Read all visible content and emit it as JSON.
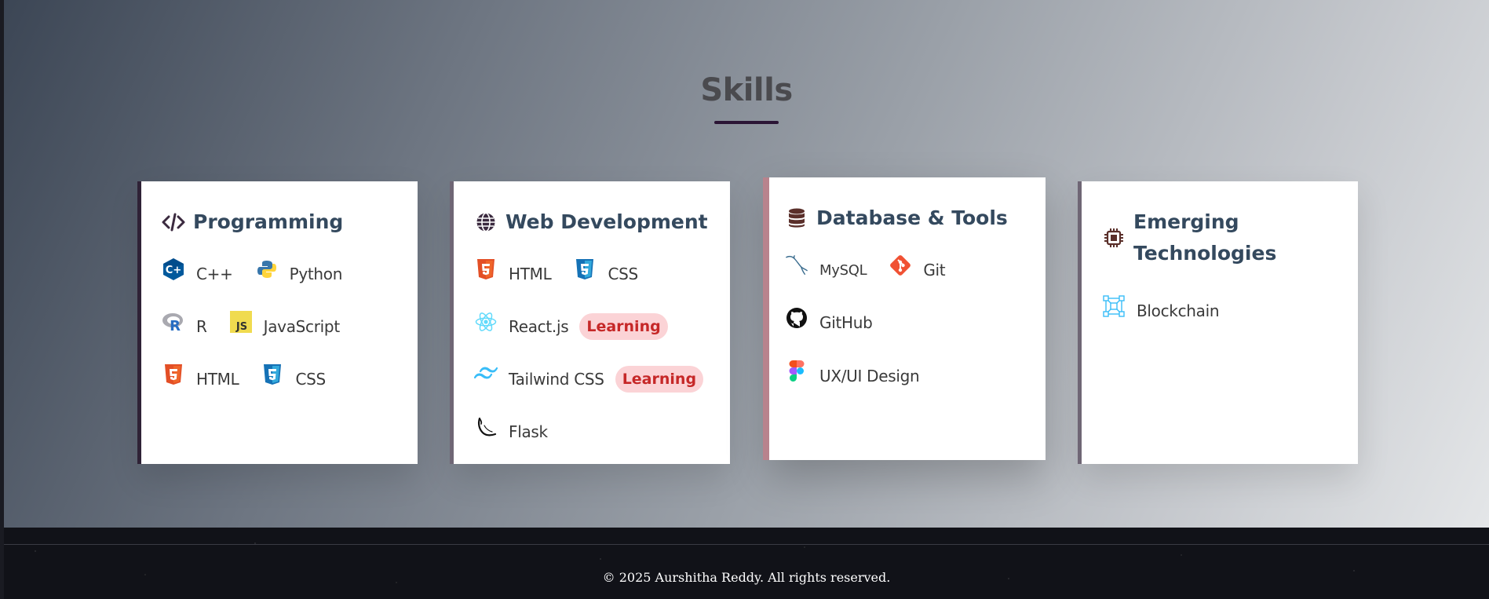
{
  "section": {
    "title": "Skills"
  },
  "cards": {
    "programming": {
      "title": "Programming",
      "icon": "code-icon",
      "accent": "#2f2236",
      "items": [
        {
          "label": "C++",
          "icon": "cpp-icon"
        },
        {
          "label": "Python",
          "icon": "python-icon"
        },
        {
          "label": "R",
          "icon": "r-icon"
        },
        {
          "label": "JavaScript",
          "icon": "javascript-icon"
        },
        {
          "label": "HTML",
          "icon": "html5-icon"
        },
        {
          "label": "CSS",
          "icon": "css3-icon"
        }
      ]
    },
    "web": {
      "title": "Web Development",
      "icon": "globe-icon",
      "accent": "#6f6675",
      "items": [
        {
          "label": "HTML",
          "icon": "html5-icon"
        },
        {
          "label": "CSS",
          "icon": "css3-icon"
        },
        {
          "label": "React.js",
          "icon": "react-icon",
          "badge": "Learning"
        },
        {
          "label": "Tailwind CSS",
          "icon": "tailwind-icon",
          "badge": "Learning"
        },
        {
          "label": "Flask",
          "icon": "flask-icon"
        }
      ]
    },
    "database": {
      "title": "Database & Tools",
      "icon": "database-icon",
      "accent": "#b8838d",
      "items": [
        {
          "label": "MySQL",
          "icon": "mysql-icon"
        },
        {
          "label": "Git",
          "icon": "git-icon"
        },
        {
          "label": "GitHub",
          "icon": "github-icon"
        },
        {
          "label": "UX/UI Design",
          "icon": "figma-icon"
        }
      ]
    },
    "emerging": {
      "title_line1": "Emerging",
      "title_line2": "Technologies",
      "icon": "chip-icon",
      "accent": "#6f6675",
      "items": [
        {
          "label": "Blockchain",
          "icon": "blockchain-icon"
        }
      ]
    }
  },
  "footer": {
    "copyright": "© 2025 Aurshitha Reddy. All rights reserved."
  },
  "colors": {
    "badge_bg": "#fbd3d6",
    "badge_text": "#c62828",
    "card_title": "#34495e",
    "html5": "#e34f26",
    "css3": "#1572b6"
  }
}
